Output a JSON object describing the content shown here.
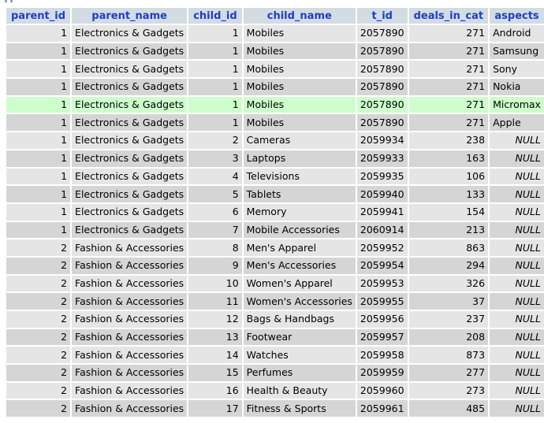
{
  "table": {
    "columns": [
      "parent_id",
      "parent_name",
      "child_id",
      "child_name",
      "t_id",
      "deals_in_cat",
      "aspects"
    ],
    "rows": [
      [
        "1",
        "Electronics & Gadgets",
        "1",
        "Mobiles",
        "2057890",
        "271",
        "Android"
      ],
      [
        "1",
        "Electronics & Gadgets",
        "1",
        "Mobiles",
        "2057890",
        "271",
        "Samsung"
      ],
      [
        "1",
        "Electronics & Gadgets",
        "1",
        "Mobiles",
        "2057890",
        "271",
        "Sony"
      ],
      [
        "1",
        "Electronics & Gadgets",
        "1",
        "Mobiles",
        "2057890",
        "271",
        "Nokia"
      ],
      [
        "1",
        "Electronics & Gadgets",
        "1",
        "Mobiles",
        "2057890",
        "271",
        "Micromax"
      ],
      [
        "1",
        "Electronics & Gadgets",
        "1",
        "Mobiles",
        "2057890",
        "271",
        "Apple"
      ],
      [
        "1",
        "Electronics & Gadgets",
        "2",
        "Cameras",
        "2059934",
        "238",
        "NULL"
      ],
      [
        "1",
        "Electronics & Gadgets",
        "3",
        "Laptops",
        "2059933",
        "163",
        "NULL"
      ],
      [
        "1",
        "Electronics & Gadgets",
        "4",
        "Televisions",
        "2059935",
        "106",
        "NULL"
      ],
      [
        "1",
        "Electronics & Gadgets",
        "5",
        "Tablets",
        "2059940",
        "133",
        "NULL"
      ],
      [
        "1",
        "Electronics & Gadgets",
        "6",
        "Memory",
        "2059941",
        "154",
        "NULL"
      ],
      [
        "1",
        "Electronics & Gadgets",
        "7",
        "Mobile Accessories",
        "2060914",
        "213",
        "NULL"
      ],
      [
        "2",
        "Fashion & Accessories",
        "8",
        "Men's Apparel",
        "2059952",
        "863",
        "NULL"
      ],
      [
        "2",
        "Fashion & Accessories",
        "9",
        "Men's Accessories",
        "2059954",
        "294",
        "NULL"
      ],
      [
        "2",
        "Fashion & Accessories",
        "10",
        "Women's Apparel",
        "2059953",
        "326",
        "NULL"
      ],
      [
        "2",
        "Fashion & Accessories",
        "11",
        "Women's Accessories",
        "2059955",
        "37",
        "NULL"
      ],
      [
        "2",
        "Fashion & Accessories",
        "12",
        "Bags & Handbags",
        "2059956",
        "237",
        "NULL"
      ],
      [
        "2",
        "Fashion & Accessories",
        "13",
        "Footwear",
        "2059957",
        "208",
        "NULL"
      ],
      [
        "2",
        "Fashion & Accessories",
        "14",
        "Watches",
        "2059958",
        "873",
        "NULL"
      ],
      [
        "2",
        "Fashion & Accessories",
        "15",
        "Perfumes",
        "2059959",
        "277",
        "NULL"
      ],
      [
        "2",
        "Fashion & Accessories",
        "16",
        "Health & Beauty",
        "2059960",
        "273",
        "NULL"
      ],
      [
        "2",
        "Fashion & Accessories",
        "17",
        "Fitness & Sports",
        "2059961",
        "485",
        "NULL"
      ]
    ],
    "marked_row": 4
  },
  "colors": {
    "header_bg": "#d3dce3",
    "header_text": "#1f3fbf",
    "row_odd": "#e5e5e5",
    "row_even": "#d5d5d5",
    "row_marked": "#ccffcc"
  }
}
